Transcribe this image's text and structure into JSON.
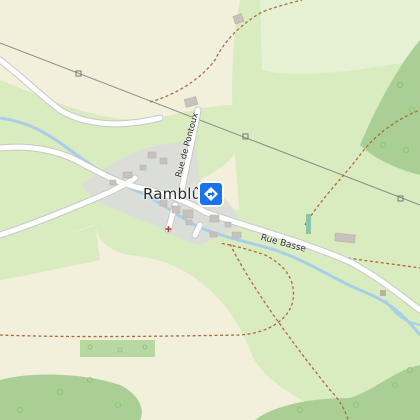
{
  "map": {
    "place_label": "Ramblûze",
    "streets": {
      "rue_basse": "Rue Basse",
      "rue_de_pontoux": "Rue de Pontoux"
    },
    "marker": {
      "icon": "directions-diamond-icon",
      "color": "#1a73e8"
    },
    "colors": {
      "background": "#f2efda",
      "meadow": "#d8ecc0",
      "forest": "#a9cf94",
      "road": "#ffffff",
      "road_casing": "#c8c8c8",
      "stream": "#a8cfe8",
      "path": "#b06a3c",
      "power_line": "#8a8a8a",
      "buildings": "#c9c2bc",
      "landuse_residential": "#dcdcdc"
    }
  }
}
